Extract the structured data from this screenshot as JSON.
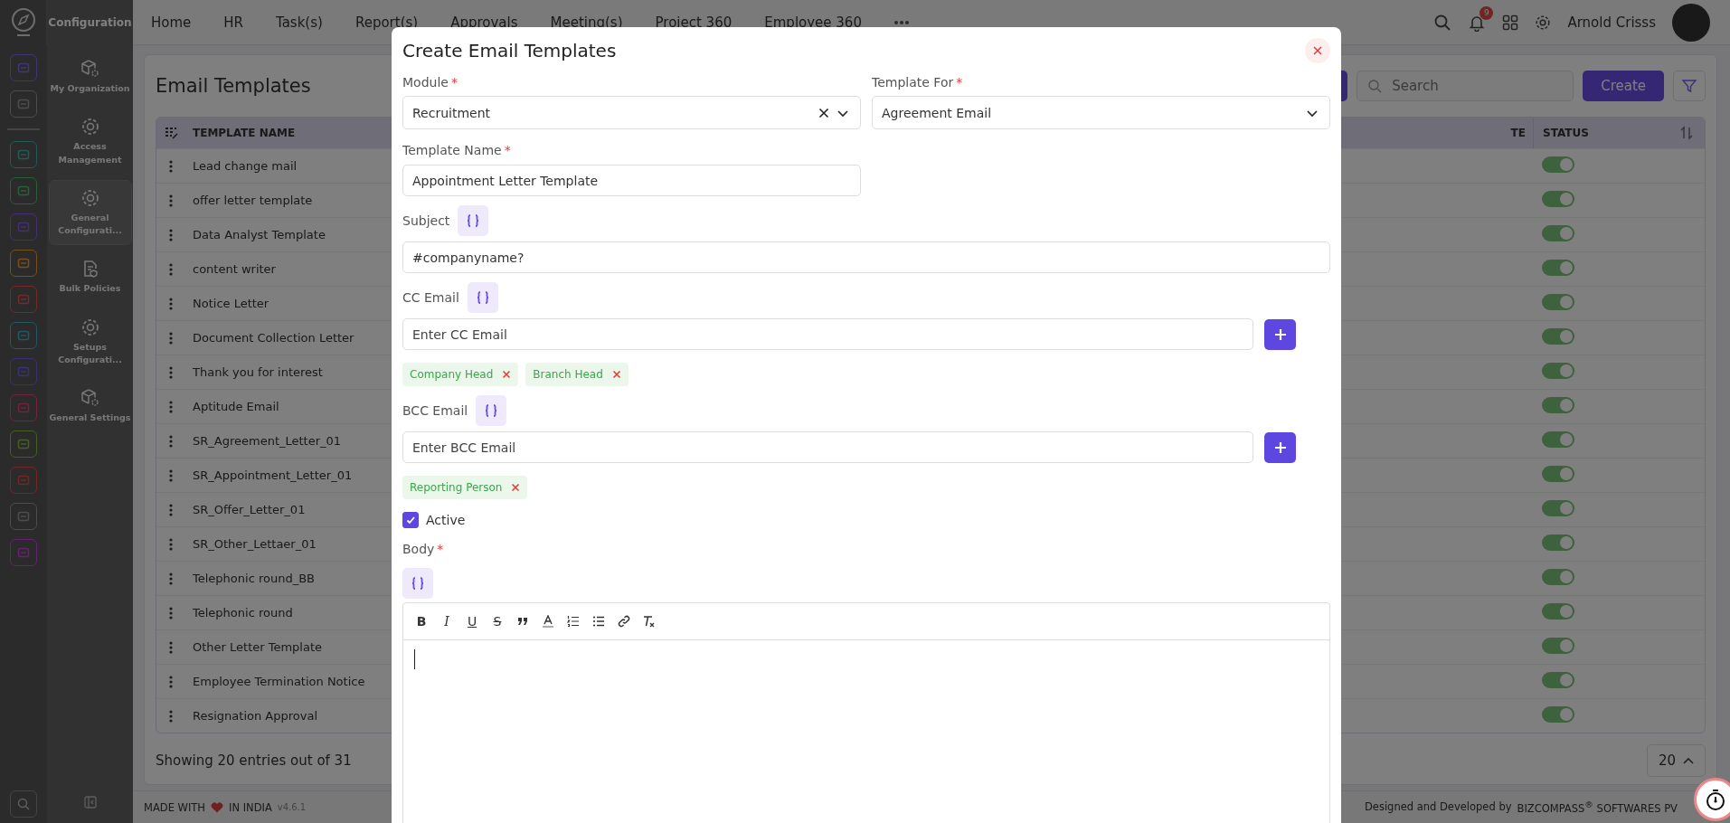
{
  "brand": {
    "title": "Configuration"
  },
  "top_nav": [
    {
      "label": "Home"
    },
    {
      "label": "HR"
    },
    {
      "label": "Task(s)"
    },
    {
      "label": "Report(s)"
    },
    {
      "label": "Approvals"
    },
    {
      "label": "Meeting(s)"
    },
    {
      "label": "Project 360"
    },
    {
      "label": "Employee 360"
    }
  ],
  "user": {
    "name": "Arnold Crisss",
    "notifications": "9"
  },
  "subnav": [
    {
      "label": "My Organization",
      "selected": false
    },
    {
      "label": "Access Management",
      "selected": false
    },
    {
      "label": "General Configurati...",
      "selected": true
    },
    {
      "label": "Bulk Policies",
      "selected": false
    },
    {
      "label": "Setups Configurati...",
      "selected": false
    },
    {
      "label": "General Settings",
      "selected": false
    }
  ],
  "page": {
    "title": "Email Templates",
    "search": {
      "placeholder": "Search"
    },
    "create": "Create"
  },
  "table": {
    "columns": [
      "TEMPLATE NAME",
      "TE",
      "STATUS"
    ],
    "rows": [
      {
        "name": "Lead change mail",
        "on": true
      },
      {
        "name": "offer letter template",
        "on": true
      },
      {
        "name": "Data Analyst Template",
        "on": true
      },
      {
        "name": "content writer",
        "on": true
      },
      {
        "name": "Notice Letter",
        "on": true
      },
      {
        "name": "Document Collection Letter",
        "on": true
      },
      {
        "name": "Thank you for interest",
        "on": true
      },
      {
        "name": "Aptitude Email",
        "on": true
      },
      {
        "name": "SR_Agreement_Letter_01",
        "on": true
      },
      {
        "name": "SR_Appointment_Letter_01",
        "on": true
      },
      {
        "name": "SR_Offer_Letter_01",
        "on": true
      },
      {
        "name": "SR_Other_Lettaer_01",
        "on": true
      },
      {
        "name": "Telephonic round_BB",
        "on": true
      },
      {
        "name": "Telephonic round",
        "on": true
      },
      {
        "name": "Other Letter Template",
        "on": true
      },
      {
        "name": "Employee Termination Notice",
        "on": true
      },
      {
        "name": "Resignation Approval",
        "on": true
      }
    ],
    "summary": "Showing 20 entries out of 31",
    "page_size": "20"
  },
  "footer": {
    "made": "MADE WITH",
    "india": "IN INDIA",
    "version": "v4.6.1",
    "designed": "Designed and Developed by",
    "company": "BIZCOMPASS$^{®}$ SOFTWARES PV"
  },
  "modal": {
    "title": "Create Email Templates",
    "module": {
      "label": "Module",
      "required_mark": "*",
      "value": "Recruitment"
    },
    "template_for": {
      "label": "Template For",
      "required_mark": "*",
      "value": "Agreement Email"
    },
    "template_name": {
      "label": "Template Name",
      "required_mark": "*",
      "value": "Appointment Letter Template"
    },
    "subject": {
      "label": "Subject",
      "value": "#companyname?"
    },
    "cc": {
      "label": "CC Email",
      "placeholder": "Enter CC Email",
      "chips": [
        "Company Head",
        "Branch Head"
      ]
    },
    "bcc": {
      "label": "BCC Email",
      "placeholder": "Enter BCC Email",
      "chips": [
        "Reporting Person"
      ]
    },
    "active": {
      "label": "Active",
      "checked": true
    },
    "body": {
      "label": "Body",
      "required_mark": "*"
    },
    "toolbar": [
      {
        "kind": "bold",
        "label": "B"
      },
      {
        "kind": "italic",
        "label": "I"
      },
      {
        "kind": "underline",
        "label": "U"
      },
      {
        "kind": "strike",
        "label": "S"
      },
      {
        "kind": "quote"
      },
      {
        "kind": "color"
      },
      {
        "kind": "ordered"
      },
      {
        "kind": "bullet"
      },
      {
        "kind": "link"
      },
      {
        "kind": "clear"
      }
    ]
  }
}
